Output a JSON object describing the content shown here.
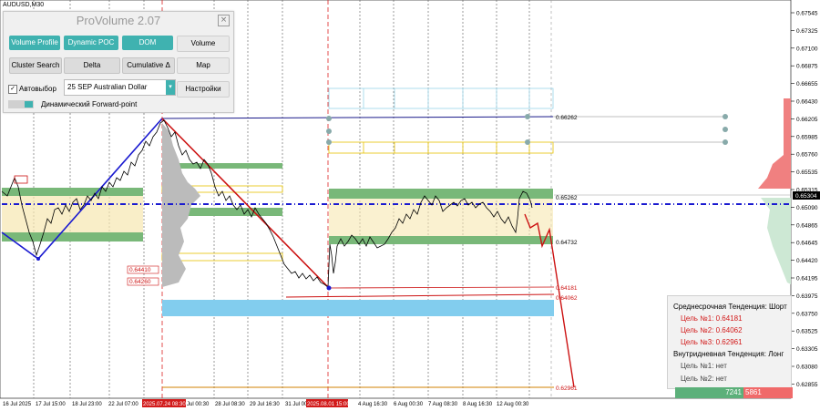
{
  "window": {
    "symbol": "AUDUSD,M30"
  },
  "panel": {
    "title": "ProVolume 2.07",
    "close": "×",
    "buttons": {
      "volume_profile": "Volume Profile",
      "dynamic_poc": "Dynamic POC",
      "dom": "DOM",
      "volume": "Volume",
      "cluster_search": "Cluster Search",
      "delta": "Delta",
      "cumulative_delta": "Cumulative Δ",
      "map": "Map"
    },
    "auto_select_label": "Автовыбор",
    "auto_select_checked": true,
    "contract": "25 SEP Australian Dollar",
    "settings": "Настройки",
    "forward_point": "Динамический Forward-point"
  },
  "price_axis": [
    "0.67545",
    "0.67325",
    "0.67100",
    "0.66875",
    "0.66655",
    "0.66430",
    "0.66205",
    "0.65985",
    "0.65760",
    "0.65535",
    "0.65315",
    "0.65090",
    "0.64865",
    "0.64645",
    "0.64420",
    "0.64195",
    "0.63975",
    "0.63750",
    "0.63525",
    "0.63305",
    "0.63080",
    "0.62855"
  ],
  "current_price": "0.65304",
  "time_axis": [
    "16 Jul 2025",
    "17 Jul 15:00",
    "18 Jul 23:00",
    "22 Jul 07:00",
    "2025.07.24 08:30",
    "Jul 00:30",
    "28 Jul 08:30",
    "29 Jul 16:30",
    "31 Jul 00:",
    "2025.08.01 15:00",
    "4 Aug 16:30",
    "6 Aug 00:30",
    "7 Aug 08:30",
    "8 Aug 16:30",
    "12 Aug 00:30"
  ],
  "chart_labels": {
    "l_66262": "0.66262",
    "l_65262": "0.65262",
    "l_64732": "0.64732",
    "l_64181": "0.64181",
    "l_64062": "0.64062",
    "l_62961": "0.62961",
    "l_64410": "0.64410",
    "l_64260": "0.64260"
  },
  "trend": {
    "medium_title": "Среднесрочная Тенденция: Шорт",
    "target1": "Цель №1:  0.64181",
    "target2": "Цель №2:  0.64062",
    "target3": "Цель №3:  0.62961",
    "intraday_title": "Внутридневная Тенденция: Лонг",
    "itarget1": "Цель №1:  нет",
    "itarget2": "Цель №2:  нет"
  },
  "volumes": {
    "buy": "7241",
    "sell": "5861"
  },
  "colors": {
    "teal": "#3fb2b0",
    "green_zone": "#5aa05a",
    "blue_zone": "#7ec8ea",
    "red_line": "#cc1111",
    "navy_line": "#1a1a8a",
    "orange": "#e0a000"
  }
}
